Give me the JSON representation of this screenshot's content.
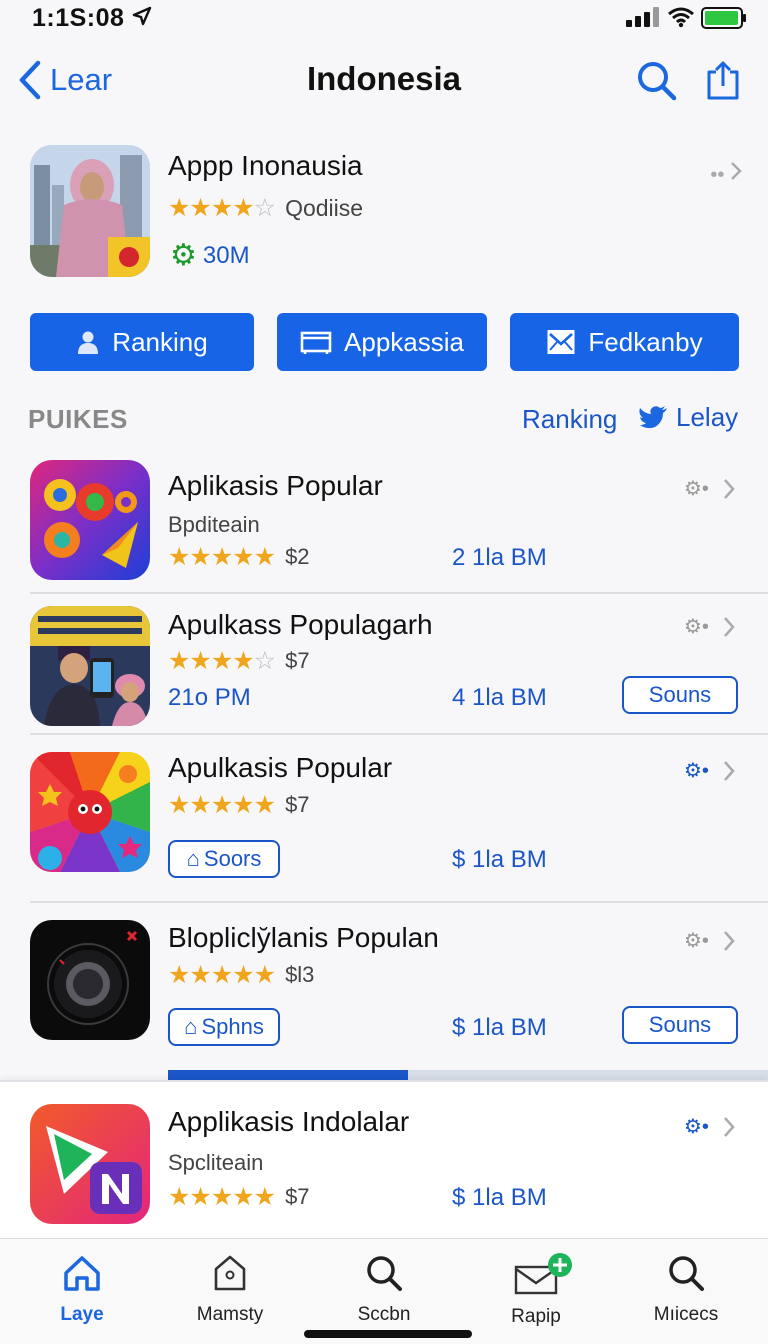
{
  "status": {
    "time": "1:1S:08"
  },
  "nav": {
    "back_label": "Lear",
    "title": "Indonesia"
  },
  "featured": {
    "name": "Appp Inonausia",
    "rating": 4,
    "subtitle": "Qodiise",
    "size": "30M"
  },
  "actions": [
    "Ranking",
    "Appkassia",
    "Fedkanby"
  ],
  "section": {
    "label": "PUIKES",
    "link1": "Ranking",
    "link2": "Lelay"
  },
  "apps": [
    {
      "name": "Aplikasis Popular",
      "sub": "Bpditeain",
      "rating": 5,
      "price": "$2",
      "size": "2 1la BM"
    },
    {
      "name": "Apulkass Populagarh",
      "rating": 4,
      "price": "$7",
      "time": "21o PM",
      "size": "4 1la BM",
      "button": "Souns"
    },
    {
      "name": "Apulkasis Popular",
      "rating": 5,
      "price": "$7",
      "chip": "Soors",
      "size": "$ 1la BM"
    },
    {
      "name": "Bloplicly̆lanis Populan",
      "rating": 5,
      "price": "$l3",
      "chip": "Sphns",
      "size": "$ 1la BM",
      "button": "Souns"
    },
    {
      "name": "Applikasis Indolalar",
      "sub": "Spcliteain",
      "rating": 5,
      "price": "$7",
      "size": "$ 1la BM"
    }
  ],
  "tabs": [
    {
      "label": "Laye",
      "active": true
    },
    {
      "label": "Mamsty"
    },
    {
      "label": "Sccbn"
    },
    {
      "label": "Rapip"
    },
    {
      "label": "Mıicecs"
    }
  ],
  "colors": {
    "accent": "#1765e6",
    "star": "#f0a51c",
    "link": "#1a56c8"
  }
}
